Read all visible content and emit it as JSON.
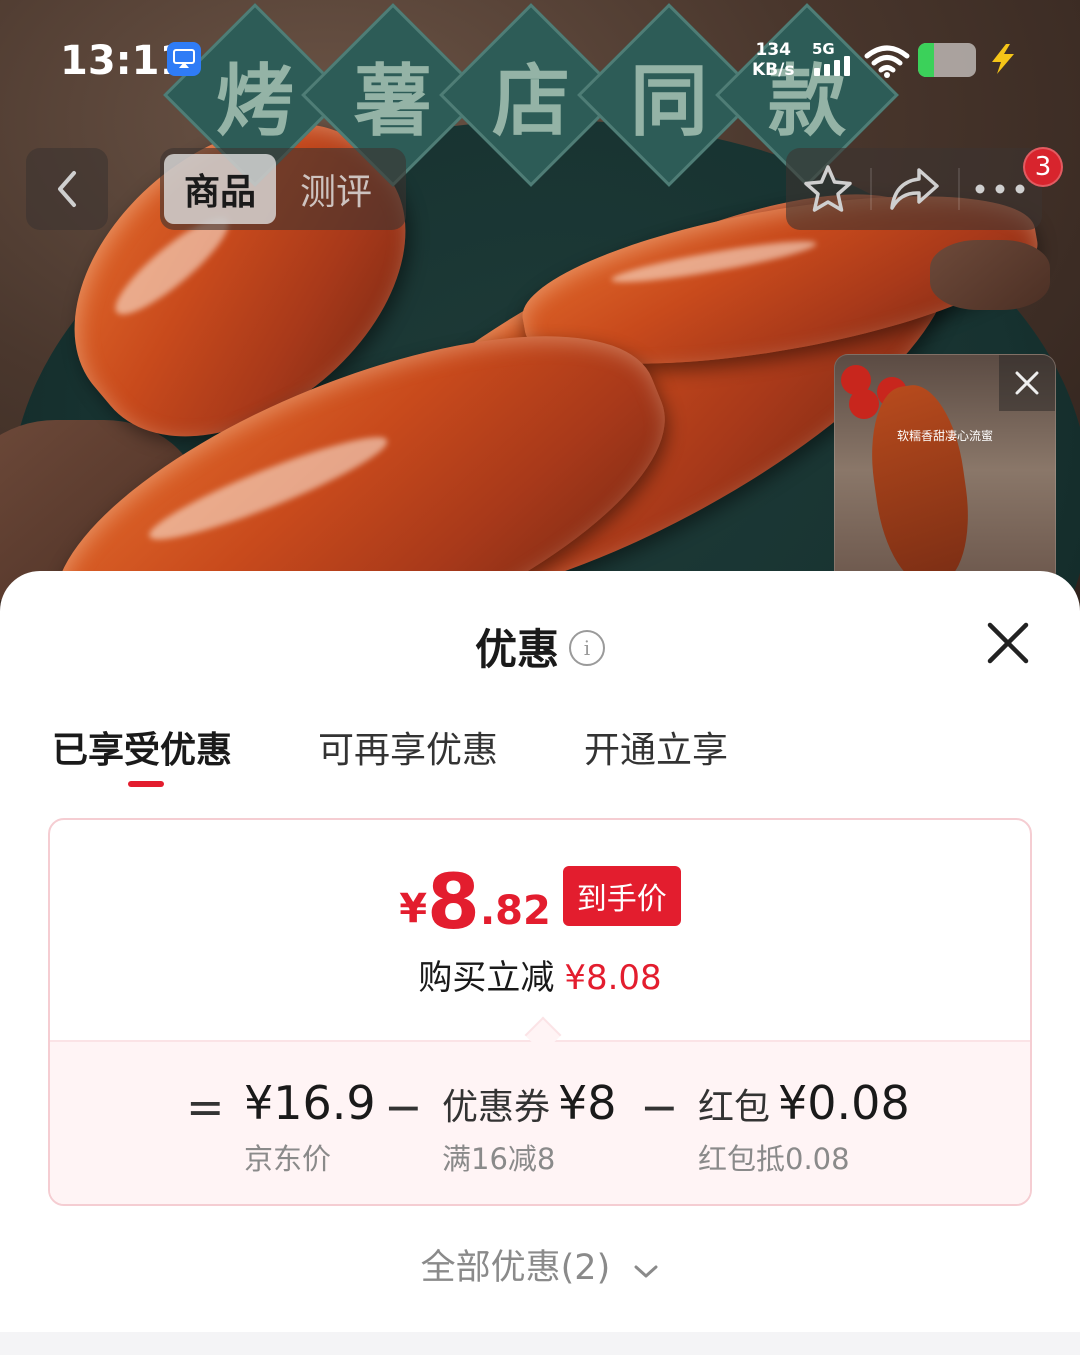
{
  "status_bar": {
    "time": "13:11",
    "net_speed_value": "134",
    "net_speed_unit": "KB/s",
    "network": "5G",
    "signal_bars": 4,
    "battery_level": 0.28,
    "icons": [
      "screen-cast-icon",
      "signal-icon",
      "wifi-icon",
      "battery-icon",
      "charging-icon"
    ]
  },
  "hero": {
    "banner_chars": [
      "烤",
      "薯",
      "店",
      "同",
      "款"
    ],
    "video_caption": "软糯香甜凄心流蜜"
  },
  "top_nav": {
    "tabs": [
      {
        "label": "商品",
        "active": true
      },
      {
        "label": "测评",
        "active": false
      }
    ],
    "message_count": "3",
    "icons": [
      "back-icon",
      "star-icon",
      "share-icon",
      "more-icon"
    ]
  },
  "sheet": {
    "title": "优惠",
    "info_glyph": "i",
    "tabs": [
      {
        "label": "已享受优惠",
        "active": true
      },
      {
        "label": "可再享优惠",
        "active": false
      },
      {
        "label": "开通立享",
        "active": false
      }
    ],
    "final_price": {
      "currency": "¥",
      "integer": "8",
      "decimal": ".82",
      "tag": "到手价"
    },
    "discount_line": {
      "label": "购买立减",
      "amount": "¥8.08"
    },
    "calculation": {
      "equals": "=",
      "minus": "−",
      "items": [
        {
          "label": "",
          "value": "¥16.9",
          "caption": "京东价"
        },
        {
          "label": "优惠券",
          "value": "¥8",
          "caption": "满16减8"
        },
        {
          "label": "红包",
          "value": "¥0.08",
          "caption": "红包抵0.08"
        }
      ]
    },
    "all_offers": "全部优惠(2)"
  },
  "colors": {
    "accent": "#e31d2e",
    "card_border": "#f5cdd2",
    "calc_bg": "#fff4f5"
  }
}
